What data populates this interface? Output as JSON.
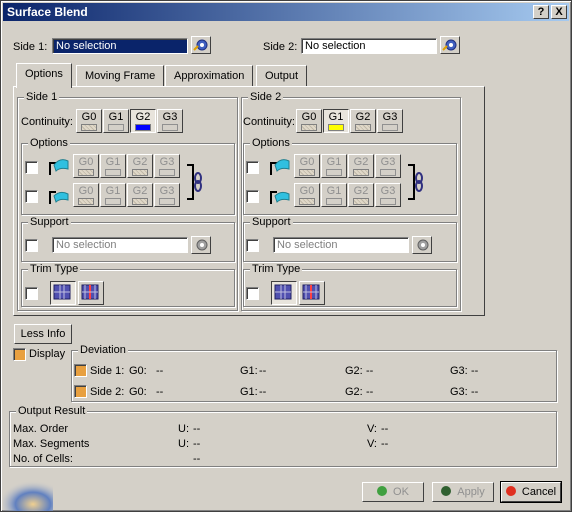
{
  "window": {
    "title": "Surface Blend",
    "help_button": "?",
    "close_button": "X"
  },
  "selection": {
    "side1_label": "Side 1:",
    "side1_value": "No selection",
    "side2_label": "Side 2:",
    "side2_value": "No selection"
  },
  "tabs": [
    {
      "label": "Options",
      "active": true
    },
    {
      "label": "Moving Frame"
    },
    {
      "label": "Approximation"
    },
    {
      "label": "Output"
    }
  ],
  "panels": {
    "side1": {
      "title": "Side 1",
      "continuity_label": "Continuity:",
      "continuity": [
        "G0",
        "G1",
        "G2",
        "G3"
      ],
      "continuity_selected": "G2",
      "options_title": "Options",
      "options_buttons": [
        "G0",
        "G1",
        "G2",
        "G3"
      ],
      "support_title": "Support",
      "support_placeholder": "No selection",
      "trim_title": "Trim Type"
    },
    "side2": {
      "title": "Side 2",
      "continuity_label": "Continuity:",
      "continuity": [
        "G0",
        "G1",
        "G2",
        "G3"
      ],
      "continuity_selected": "G1",
      "options_title": "Options",
      "options_buttons": [
        "G0",
        "G1",
        "G2",
        "G3"
      ],
      "support_title": "Support",
      "support_placeholder": "No selection",
      "trim_title": "Trim Type"
    }
  },
  "less_info_label": "Less Info",
  "display_label": "Display",
  "deviation": {
    "title": "Deviation",
    "rows": [
      {
        "side": "Side 1:",
        "g0_label": "G0:",
        "g0": "--",
        "g1_label": "G1:",
        "g1": "--",
        "g2_label": "G2:",
        "g2": "--",
        "g3_label": "G3:",
        "g3": "--"
      },
      {
        "side": "Side 2:",
        "g0_label": "G0:",
        "g0": "--",
        "g1_label": "G1:",
        "g1": "--",
        "g2_label": "G2:",
        "g2": "--",
        "g3_label": "G3:",
        "g3": "--"
      }
    ]
  },
  "output_result": {
    "title": "Output Result",
    "max_order_label": "Max. Order",
    "max_order_u_label": "U:",
    "max_order_u": "--",
    "max_order_v_label": "V:",
    "max_order_v": "--",
    "max_segments_label": "Max. Segments",
    "max_segments_u_label": "U:",
    "max_segments_u": "--",
    "max_segments_v_label": "V:",
    "max_segments_v": "--",
    "cells_label": "No. of Cells:",
    "cells_value": "--"
  },
  "buttons": {
    "ok": "OK",
    "apply": "Apply",
    "cancel": "Cancel"
  },
  "colors": {
    "titlebar": "#0a246a",
    "selected_field": "#0a246a",
    "g2_swatch": "#0000ff",
    "g1_swatch": "#ffff00",
    "checkbox_on": "#e8a040"
  }
}
